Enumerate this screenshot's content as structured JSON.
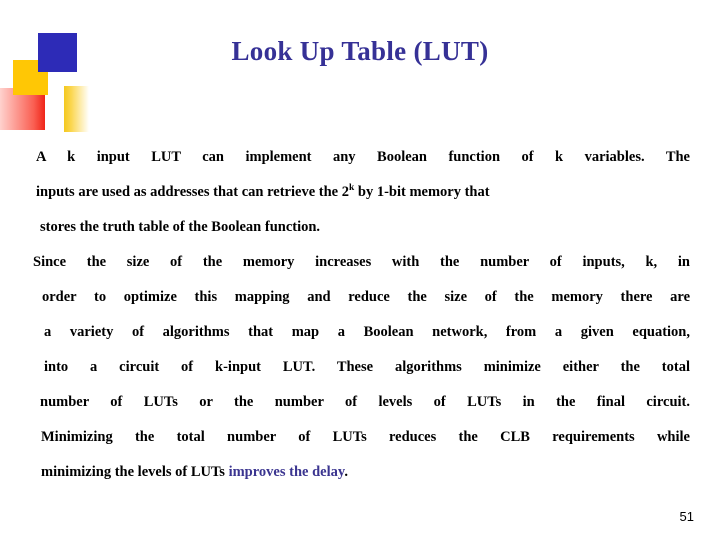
{
  "slide": {
    "title": "Look Up Table (LUT)",
    "title_color": "#363196",
    "background_color": "#ffffff",
    "page_number": "51"
  },
  "decorations": [
    {
      "name": "blue-square",
      "color": "#2d2bb7"
    },
    {
      "name": "yellow-square",
      "color": "#ffc705"
    },
    {
      "name": "red-gradient-rect",
      "color": "#ef2418"
    },
    {
      "name": "yellow-gradient-rect",
      "color": "#f4c81e"
    }
  ],
  "body": {
    "lines": [
      {
        "text": "A  k  input  LUT   can  implement  any  Boolean  function  of  k  variables.  The"
      },
      {
        "pre": "inputs are used  as addresses that can retrieve the 2",
        "sup": "k",
        "post": " by 1-bit memory that"
      },
      {
        "text": "stores the truth table of the Boolean function."
      },
      {
        "text": "Since  the  size  of  the  memory  increases  with  the  number  of  inputs,  k,   in"
      },
      {
        "text": "order to optimize this mapping and reduce the size of the memory there are"
      },
      {
        "text": "a variety of algorithms that map a Boolean network, from a given equation,"
      },
      {
        "text": "into a circuit of k-input LUT. These algorithms  minimize either the total"
      },
      {
        "text": "number  of  LUTs  or  the  number  of  levels  of  LUTs  in  the  final  circuit."
      },
      {
        "text": "Minimizing the total number of LUTs reduces the CLB requirements while"
      },
      {
        "pre2": "minimizing the levels of LUTs ",
        "accent": "improves the delay",
        "post2": "."
      }
    ]
  }
}
